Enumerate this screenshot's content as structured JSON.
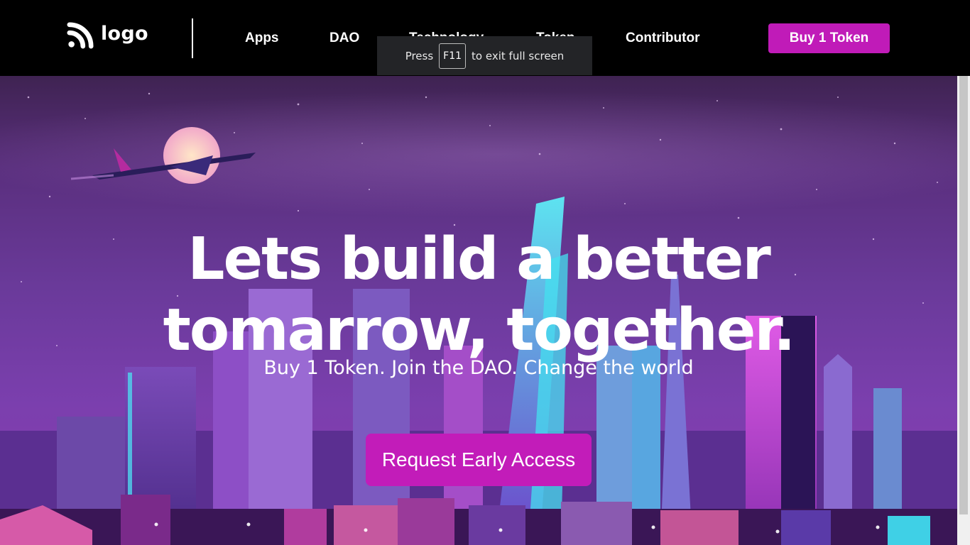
{
  "header": {
    "logo_text": "logo",
    "nav": [
      "Apps",
      "DAO",
      "Technology",
      "Token",
      "Contributor"
    ],
    "buy_button": "Buy 1 Token"
  },
  "fullscreen_toast": {
    "prefix": "Press",
    "key": "F11",
    "suffix": "to exit full screen"
  },
  "hero": {
    "headline_line1": "Lets build a better",
    "headline_line2": "tomarrow, together.",
    "subheadline": "Buy 1 Token. Join the DAO. Change the world",
    "cta_button": "Request Early Access"
  },
  "colors": {
    "accent": "#c01bb8",
    "header_bg": "#000000",
    "hero_sky": "#6a3a9a"
  }
}
